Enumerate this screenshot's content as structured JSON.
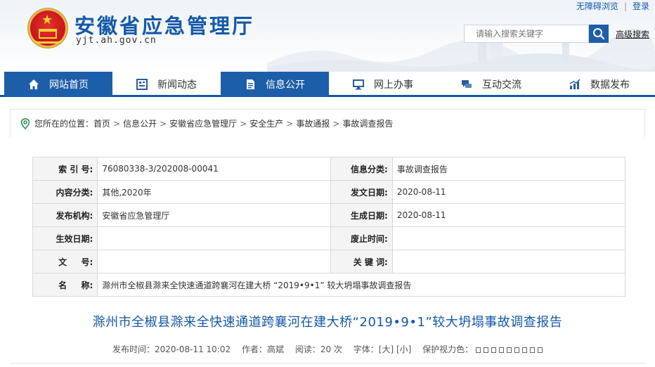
{
  "header": {
    "site_title": "安徽省应急管理厅",
    "site_domain": "yjt.ah.gov.cn",
    "top_links": {
      "accessibility": "无障碍浏览",
      "login": "登录"
    },
    "search": {
      "placeholder": "请输入搜索关键字",
      "advanced": "高级搜索"
    }
  },
  "nav": [
    {
      "label": "网站首页",
      "icon": "home-icon",
      "active": true
    },
    {
      "label": "新闻动态",
      "icon": "news-icon",
      "active": false
    },
    {
      "label": "信息公开",
      "icon": "document-icon",
      "active": true
    },
    {
      "label": "网上办事",
      "icon": "monitor-icon",
      "active": false
    },
    {
      "label": "互动交流",
      "icon": "chat-icon",
      "active": false
    },
    {
      "label": "数据发布",
      "icon": "chart-icon",
      "active": false
    }
  ],
  "breadcrumb": {
    "prefix": "您所在的位置：",
    "items": [
      "首页",
      "信息公开",
      "安徽省应急管理厅",
      "安全生产",
      "事故通报",
      "事故调查报告"
    ],
    "arrow": ">"
  },
  "info": {
    "index_label": "索 引 号:",
    "index_value": "76080338-3/202008-00041",
    "category_label": "信息分类:",
    "category_value": "事故调查报告",
    "content_label": "内容分类:",
    "content_value": "其他,2020年",
    "issue_date_label": "发文日期:",
    "issue_date_value": "2020-08-11",
    "publisher_label": "发布机构:",
    "publisher_value": "安徽省应急管理厅",
    "generate_label": "生成日期:",
    "generate_value": "2020-08-11",
    "effective_label": "生效日期:",
    "effective_value": "",
    "abolish_label": "废止时间:",
    "abolish_value": "",
    "doc_no_label": "文 　 号:",
    "doc_no_value": "",
    "keywords_label": "关 键 词:",
    "keywords_value": "",
    "name_label": "名 　 称:",
    "name_value": "滁州市全椒县滁来全快速通道跨襄河在建大桥 “2019•9•1” 较大坍塌事故调查报告"
  },
  "article": {
    "title": "滁州市全椒县滁来全快速通道跨襄河在建大桥“2019•9•1”较大坍塌事故调查报告",
    "publish_time_label": "发布时间：",
    "publish_time": "2020-08-11 10:02",
    "author_label": "作者：",
    "author": "高斌",
    "reads_label": "阅读：",
    "reads": "20 次",
    "font_label": "字体：",
    "font_large": "[大]",
    "font_small": "[小]",
    "eye_label": "保护视力色："
  },
  "colors": {
    "brand_blue": "#1459a8",
    "nav_active": "#1d5ea9"
  }
}
